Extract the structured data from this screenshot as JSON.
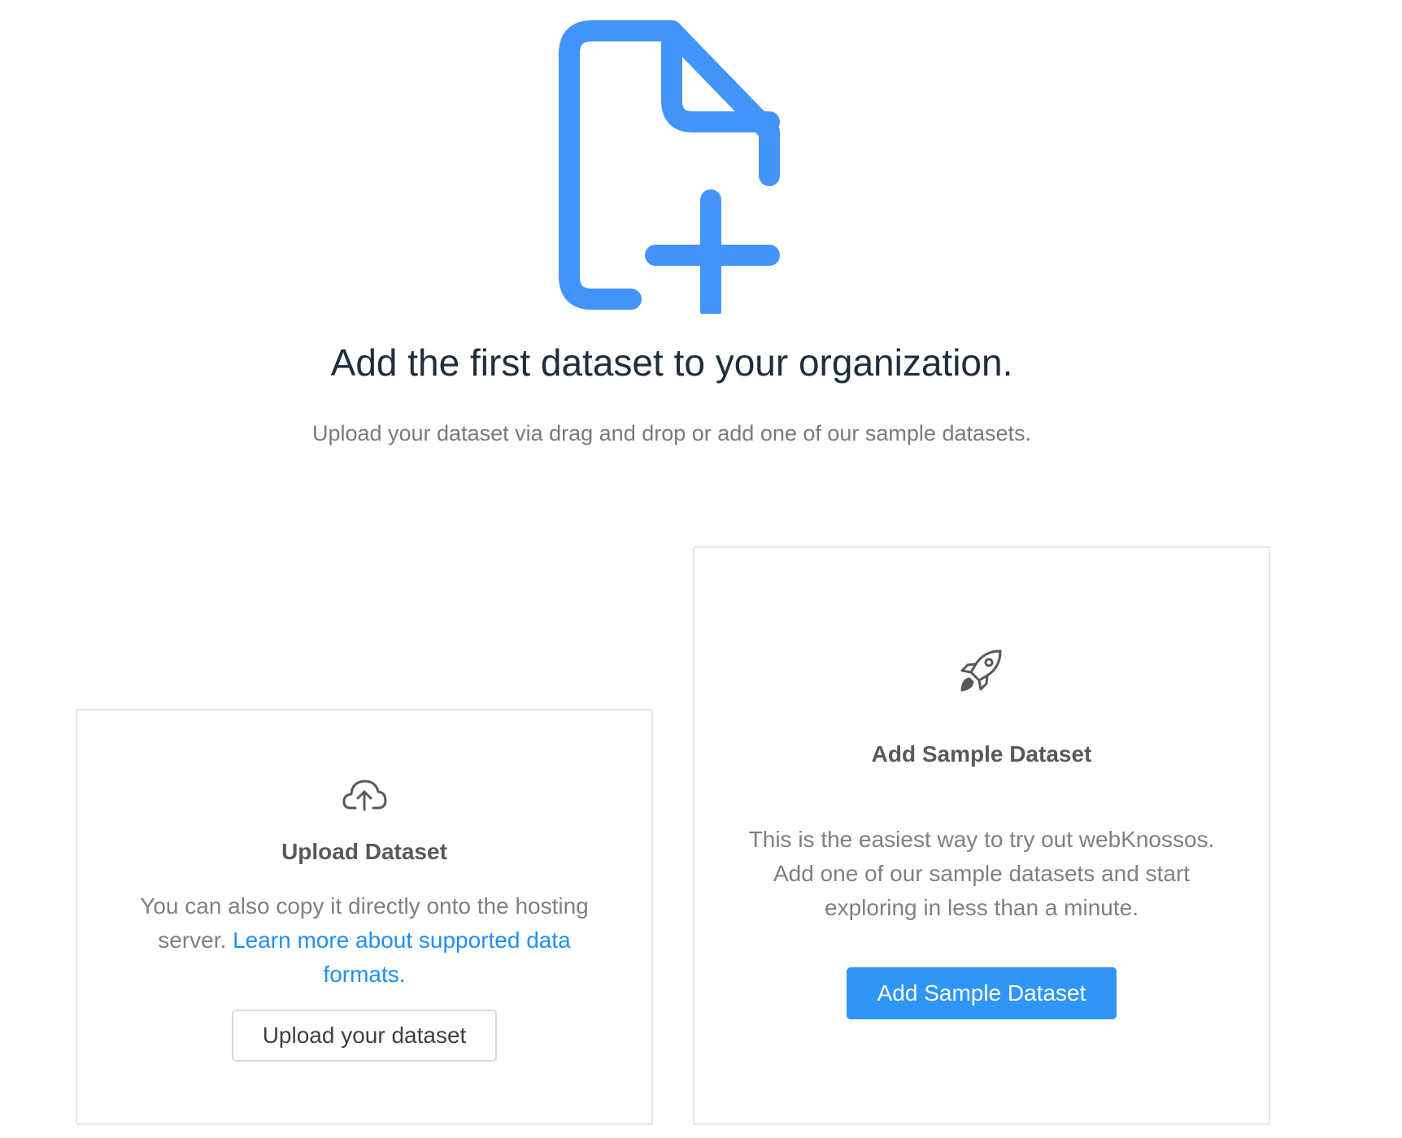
{
  "hero": {
    "icon": "file-add-icon",
    "accent_color": "#4294fb",
    "title": "Add the first dataset to your organization.",
    "subtitle": "Upload your dataset via drag and drop or add one of our sample datasets."
  },
  "upload_card": {
    "icon": "cloud-upload-icon",
    "title": "Upload Dataset",
    "description": "You can also copy it directly onto the hosting server.",
    "link_text": "Learn more about supported data formats.",
    "button_label": "Upload your dataset"
  },
  "sample_card": {
    "icon": "rocket-icon",
    "title": "Add Sample Dataset",
    "description": "This is the easiest way to try out webKnossos. Add one of our sample datasets and start exploring in less than a minute.",
    "button_label": "Add Sample Dataset",
    "button_color": "#2f95f7"
  }
}
